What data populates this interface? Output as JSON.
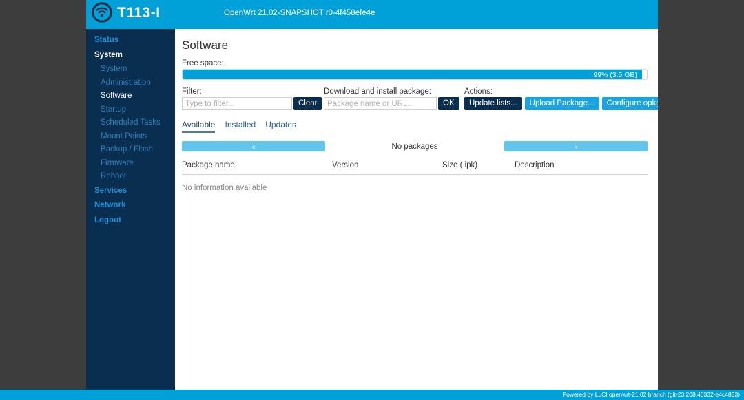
{
  "header": {
    "brand_name": "T113-I",
    "logo_icon": "wifi-signal-icon",
    "version_text": "OpenWrt 21.02-SNAPSHOT r0-4f458efe4e",
    "background_color": "#00a0d8"
  },
  "sidebar": {
    "background_color": "#0a2e4f",
    "items": [
      {
        "label": "Status",
        "level": "top",
        "active": false
      },
      {
        "label": "System",
        "level": "top",
        "active": true
      },
      {
        "label": "System",
        "level": "sub",
        "active": false
      },
      {
        "label": "Administration",
        "level": "sub",
        "active": false
      },
      {
        "label": "Software",
        "level": "sub",
        "active": true
      },
      {
        "label": "Startup",
        "level": "sub",
        "active": false
      },
      {
        "label": "Scheduled Tasks",
        "level": "sub",
        "active": false
      },
      {
        "label": "Mount Points",
        "level": "sub",
        "active": false
      },
      {
        "label": "Backup / Flash",
        "level": "sub",
        "active": false
      },
      {
        "label": "Firmware",
        "level": "sub",
        "active": false
      },
      {
        "label": "Reboot",
        "level": "sub",
        "active": false
      },
      {
        "label": "Services",
        "level": "top",
        "active": false
      },
      {
        "label": "Network",
        "level": "top",
        "active": false
      },
      {
        "label": "Logout",
        "level": "top",
        "active": false
      }
    ]
  },
  "main": {
    "page_title": "Software",
    "free_space": {
      "label": "Free space:",
      "value_text": "99% (3.5 GB)",
      "percent": 99,
      "fill_color": "#00a0d8"
    },
    "filter": {
      "label": "Filter:",
      "placeholder": "Type to filter...",
      "value": "",
      "clear_label": "Clear"
    },
    "download": {
      "label": "Download and install package:",
      "placeholder": "Package name or URL...",
      "value": "",
      "ok_label": "OK"
    },
    "actions": {
      "label": "Actions:",
      "update_lists_label": "Update lists...",
      "upload_package_label": "Upload Package...",
      "configure_opkg_label": "Configure opkg..."
    },
    "tabs": [
      {
        "label": "Available",
        "active": true
      },
      {
        "label": "Installed",
        "active": false
      },
      {
        "label": "Updates",
        "active": false
      }
    ],
    "pagination": {
      "prev_label": "«",
      "next_label": "»",
      "status": "No packages"
    },
    "table": {
      "columns": [
        "Package name",
        "Version",
        "Size (.ipk)",
        "Description"
      ],
      "rows": [],
      "empty_text": "No information available"
    }
  },
  "footer": {
    "text": "Powered by LuCI openwrt-21.02 branch (git-23.208.40332-e4c4833)",
    "background_color": "#00a0d8"
  }
}
